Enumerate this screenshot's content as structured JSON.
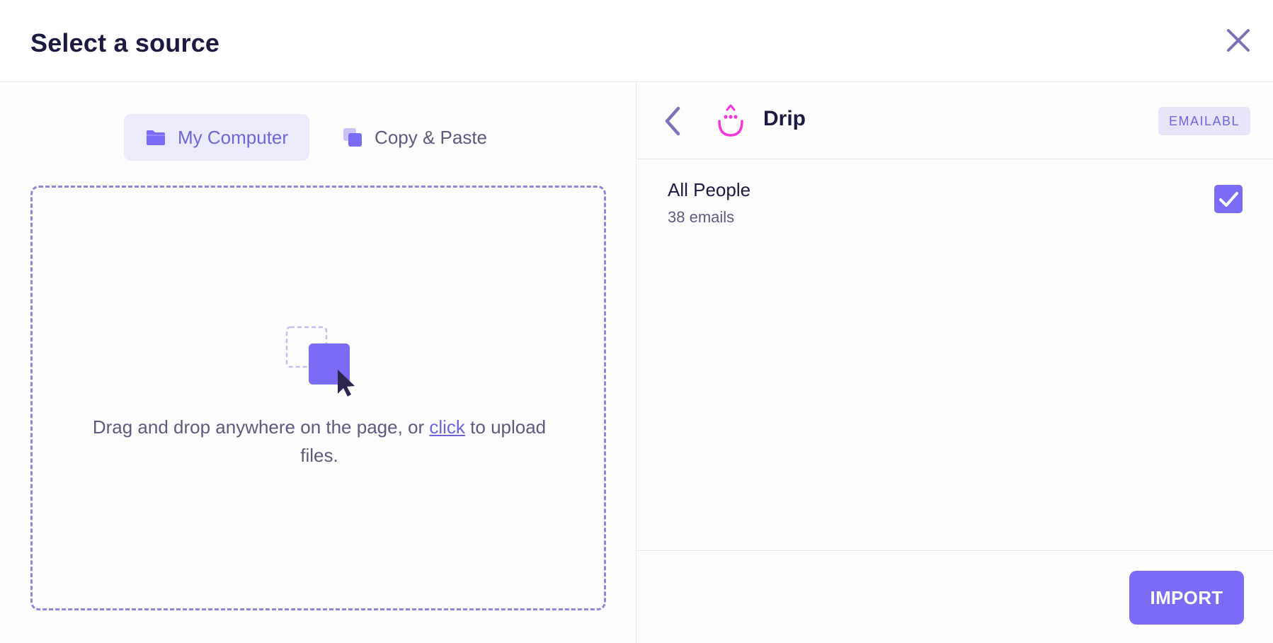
{
  "header": {
    "title": "Select a source",
    "close_icon": "close-icon"
  },
  "left": {
    "tabs": [
      {
        "label": "My Computer",
        "icon": "folder-icon",
        "active": true
      },
      {
        "label": "Copy & Paste",
        "icon": "copy-icon",
        "active": false
      }
    ],
    "dropzone": {
      "text_before": "Drag and drop anywhere on the page, or ",
      "link": "click",
      "text_after": " to upload files."
    }
  },
  "right": {
    "back_icon": "chevron-left-icon",
    "provider": {
      "name": "Drip",
      "logo": "drip-logo-icon"
    },
    "badge": "EMAILABL",
    "list": [
      {
        "name": "All People",
        "count": "38 emails",
        "checked": true
      }
    ],
    "import_label": "IMPORT"
  },
  "colors": {
    "accent": "#7b6cf6",
    "accent_text": "#6f64d8",
    "drip_pink": "#ef3ad9",
    "title": "#1c1a40",
    "muted": "#5e5a7e"
  }
}
